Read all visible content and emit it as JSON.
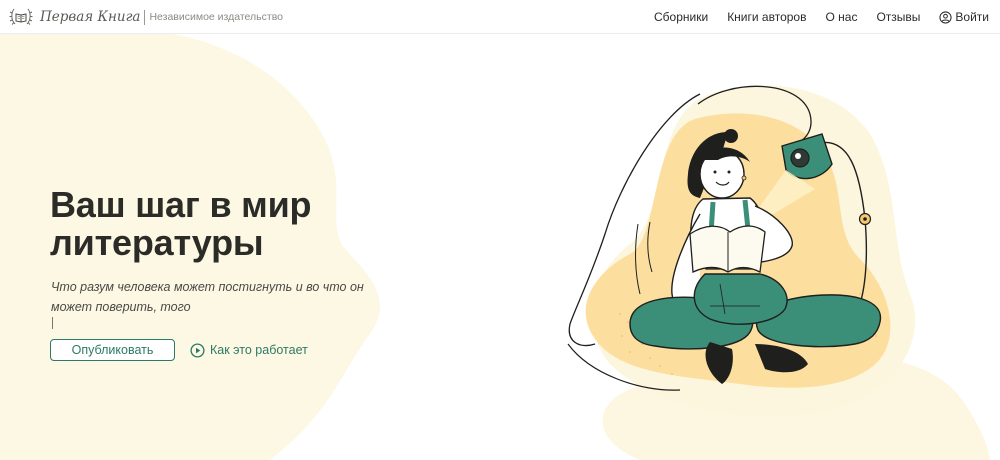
{
  "brand": {
    "name": "Первая Книга",
    "tagline": "Независимое издательство"
  },
  "nav": {
    "items": [
      "Сборники",
      "Книги авторов",
      "О нас",
      "Отзывы"
    ],
    "login_label": "Войти"
  },
  "hero": {
    "title_line1": "Ваш шаг в мир",
    "title_line2": "литературы",
    "subtitle_line1": "Что разум человека может постигнуть и во что он",
    "subtitle_line2": "может поверить, того",
    "publish_label": "Опубликовать",
    "how_label": "Как это работает"
  },
  "colors": {
    "accent": "#2c7a63",
    "text": "#2b2b28",
    "blob_cream": "#fdf7e2",
    "blob_yellow": "#fce3a4",
    "figure_green": "#3b8f78"
  },
  "icons": {
    "logo": "laurel-book-icon",
    "login": "user-circle-icon",
    "how": "play-circle-icon"
  }
}
